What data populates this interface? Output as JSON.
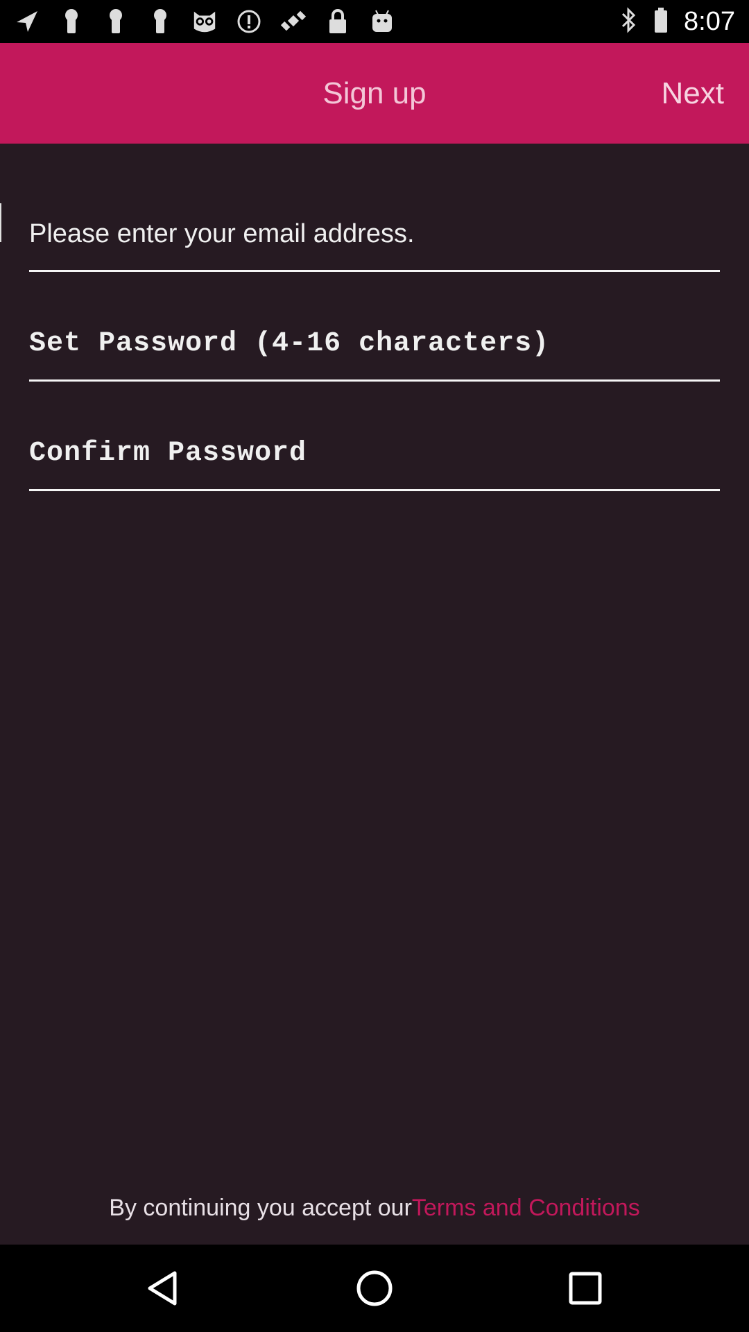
{
  "status_bar": {
    "time": "8:07",
    "icons": [
      "navigation-icon",
      "keyhole-icon",
      "keyhole-icon",
      "keyhole-icon",
      "owl-icon",
      "info-icon",
      "satellite-icon",
      "lock-icon",
      "android-icon",
      "bluetooth-icon",
      "battery-icon"
    ]
  },
  "header": {
    "title": "Sign up",
    "next_label": "Next",
    "color": "#C2185B"
  },
  "form": {
    "email_placeholder": "Please enter your email address.",
    "password_placeholder": "Set Password (4-16 characters)",
    "confirm_placeholder": "Confirm Password"
  },
  "footer": {
    "terms_prefix": "By continuing you accept our",
    "terms_link": "Terms and Conditions"
  },
  "nav": {
    "icons": [
      "back-icon",
      "home-icon",
      "recents-icon"
    ]
  }
}
